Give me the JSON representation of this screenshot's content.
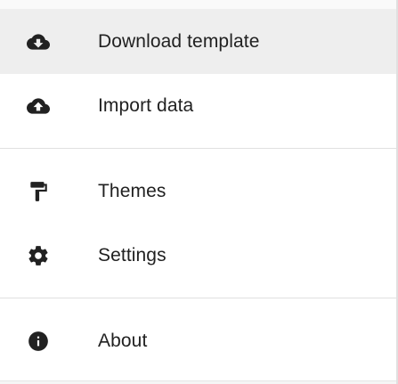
{
  "menu": {
    "items": [
      {
        "label": "Download template",
        "icon": "cloud-download-icon",
        "active": true
      },
      {
        "label": "Import data",
        "icon": "cloud-upload-icon",
        "active": false
      },
      {
        "label": "Themes",
        "icon": "paint-roller-icon",
        "active": false
      },
      {
        "label": "Settings",
        "icon": "gear-icon",
        "active": false
      },
      {
        "label": "About",
        "icon": "info-icon",
        "active": false
      }
    ]
  }
}
